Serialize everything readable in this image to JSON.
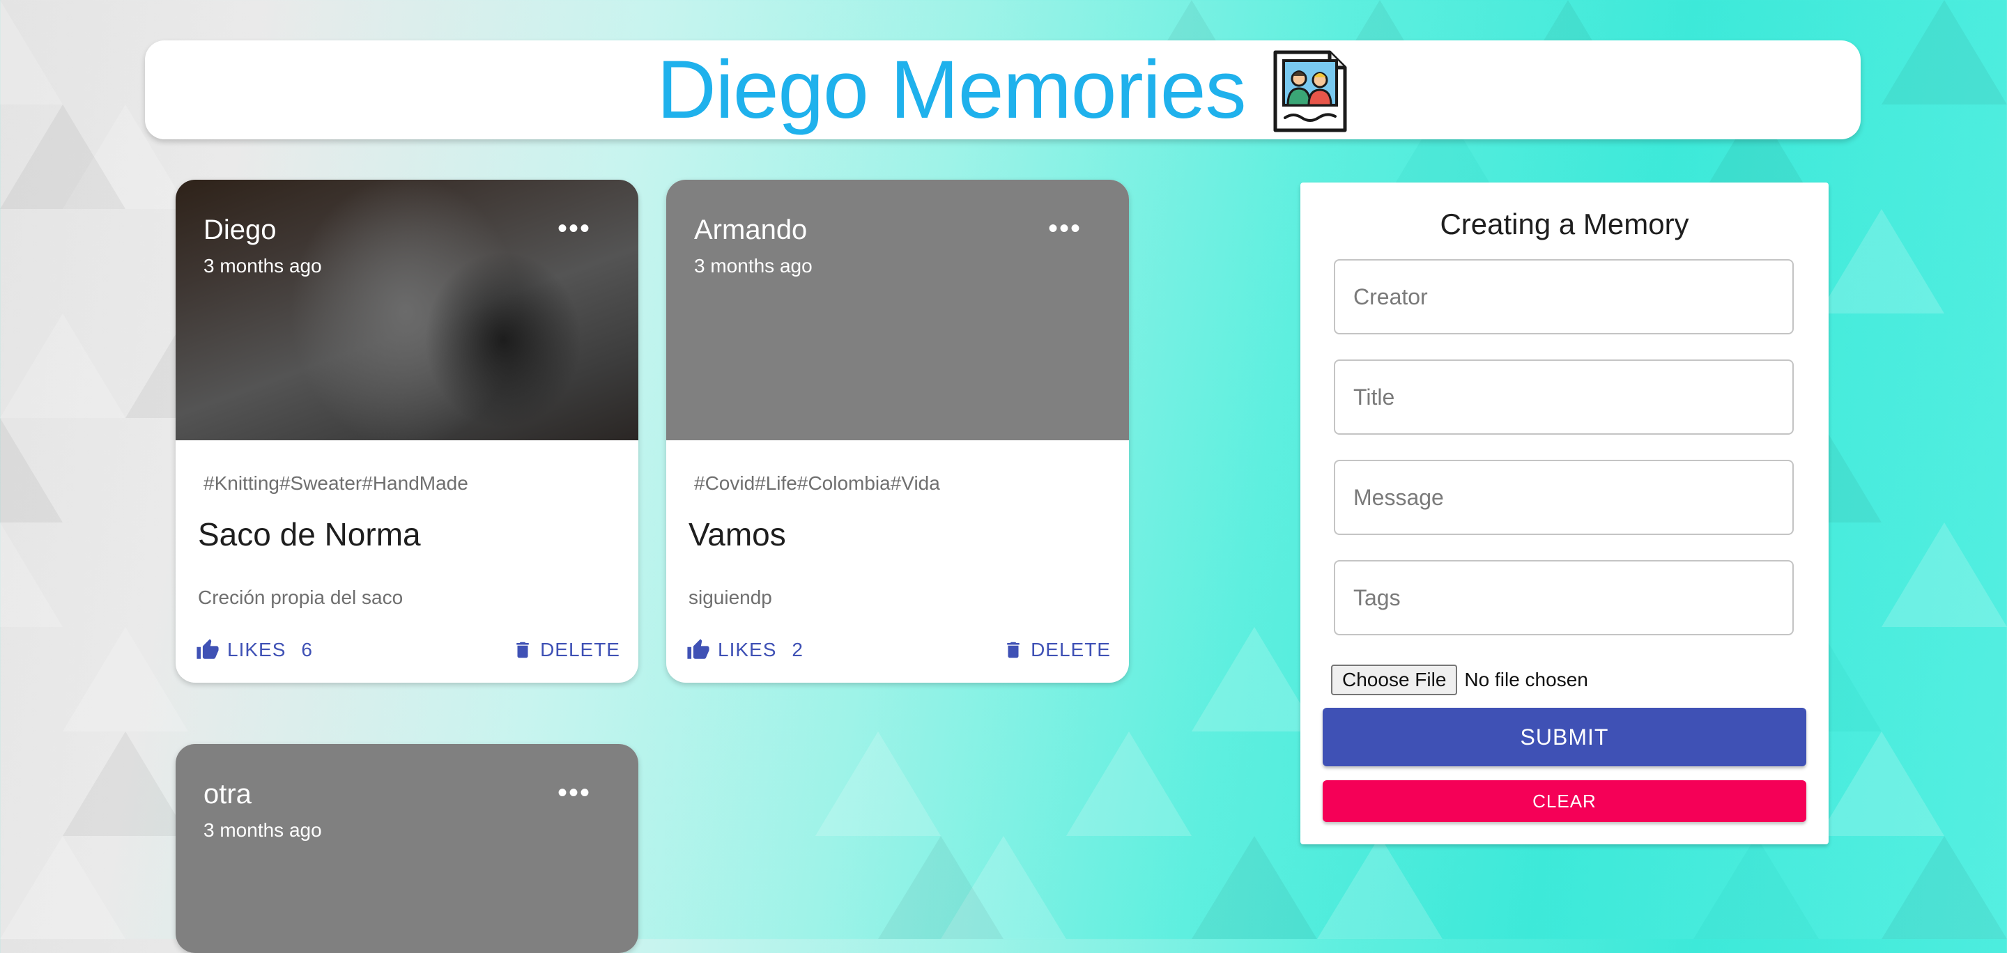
{
  "app": {
    "title": "Diego Memories",
    "title_color": "#1fb1ec",
    "logo_icon": "photo-memories-icon"
  },
  "posts": [
    {
      "creator": "Diego",
      "time": "3 months ago",
      "tags": "#Knitting#Sweater#HandMade",
      "title": "Saco de Norma",
      "message": "Creción propia del saco",
      "likes_label": "LIKES",
      "likes_count": "6",
      "delete_label": "DELETE",
      "has_image": true
    },
    {
      "creator": "Armando",
      "time": "3 months ago",
      "tags": "#Covid#Life#Colombia#Vida",
      "title": "Vamos",
      "message": "siguiendp",
      "likes_label": "LIKES",
      "likes_count": "2",
      "delete_label": "DELETE",
      "has_image": false
    },
    {
      "creator": "otra",
      "time": "3 months ago",
      "has_image": false
    }
  ],
  "form": {
    "title": "Creating a Memory",
    "creator_placeholder": "Creator",
    "title_placeholder": "Title",
    "message_placeholder": "Message",
    "tags_placeholder": "Tags",
    "file_button": "Choose File",
    "file_status": "No file chosen",
    "submit_label": "SUBMIT",
    "clear_label": "CLEAR"
  },
  "colors": {
    "primary": "#3f51b5",
    "secondary": "#f50057",
    "media_placeholder": "#808080"
  }
}
